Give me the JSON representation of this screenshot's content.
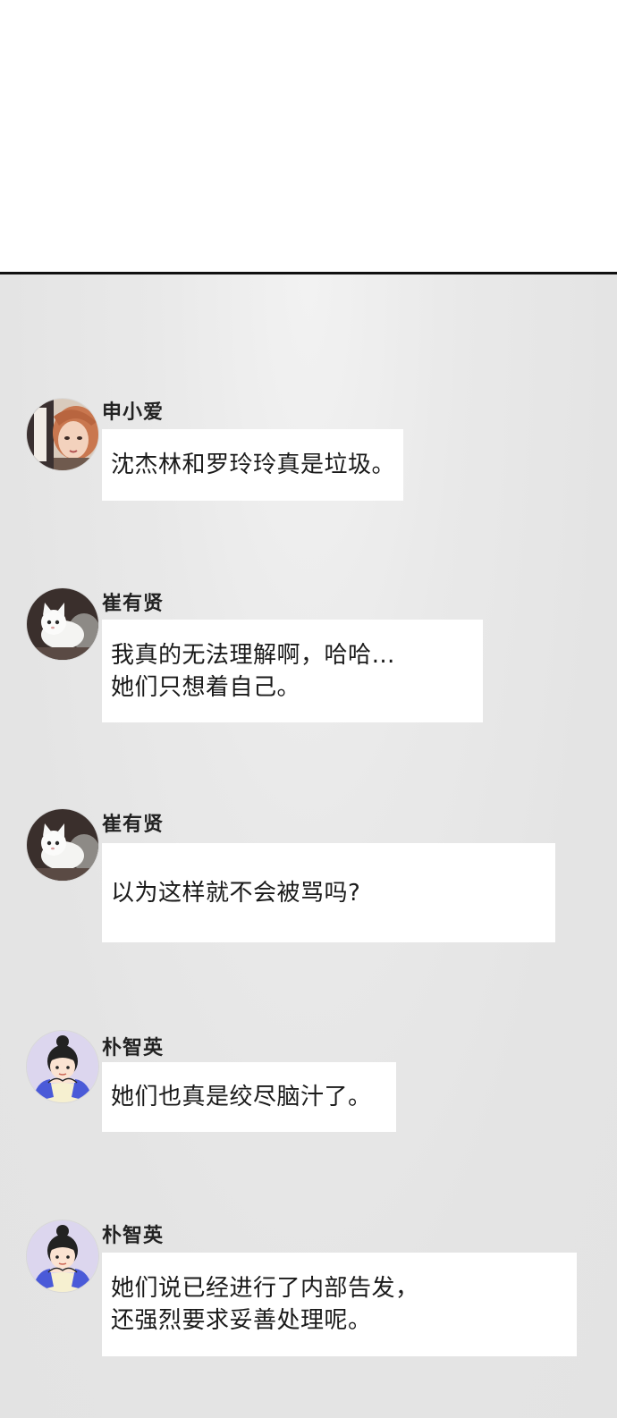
{
  "messages": [
    {
      "sender": "申小爱",
      "avatar_icon": "woman-portrait-avatar",
      "lines": [
        "沈杰林和罗玲玲真是垃圾。"
      ]
    },
    {
      "sender": "崔有贤",
      "avatar_icon": "white-cat-avatar",
      "lines": [
        "我真的无法理解啊，哈哈…",
        "她们只想着自己。"
      ]
    },
    {
      "sender": "崔有贤",
      "avatar_icon": "white-cat-avatar",
      "lines": [
        "以为这样就不会被骂吗?"
      ]
    },
    {
      "sender": "朴智英",
      "avatar_icon": "cartoon-girl-avatar",
      "lines": [
        "她们也真是绞尽脑汁了。"
      ]
    },
    {
      "sender": "朴智英",
      "avatar_icon": "cartoon-girl-avatar",
      "lines": [
        "她们说已经进行了内部告发，",
        "还强烈要求妥善处理呢。"
      ]
    }
  ],
  "colors": {
    "background_top": "#ffffff",
    "chat_background": "#e6e6e6",
    "bubble": "#ffffff",
    "divider": "#111111"
  }
}
